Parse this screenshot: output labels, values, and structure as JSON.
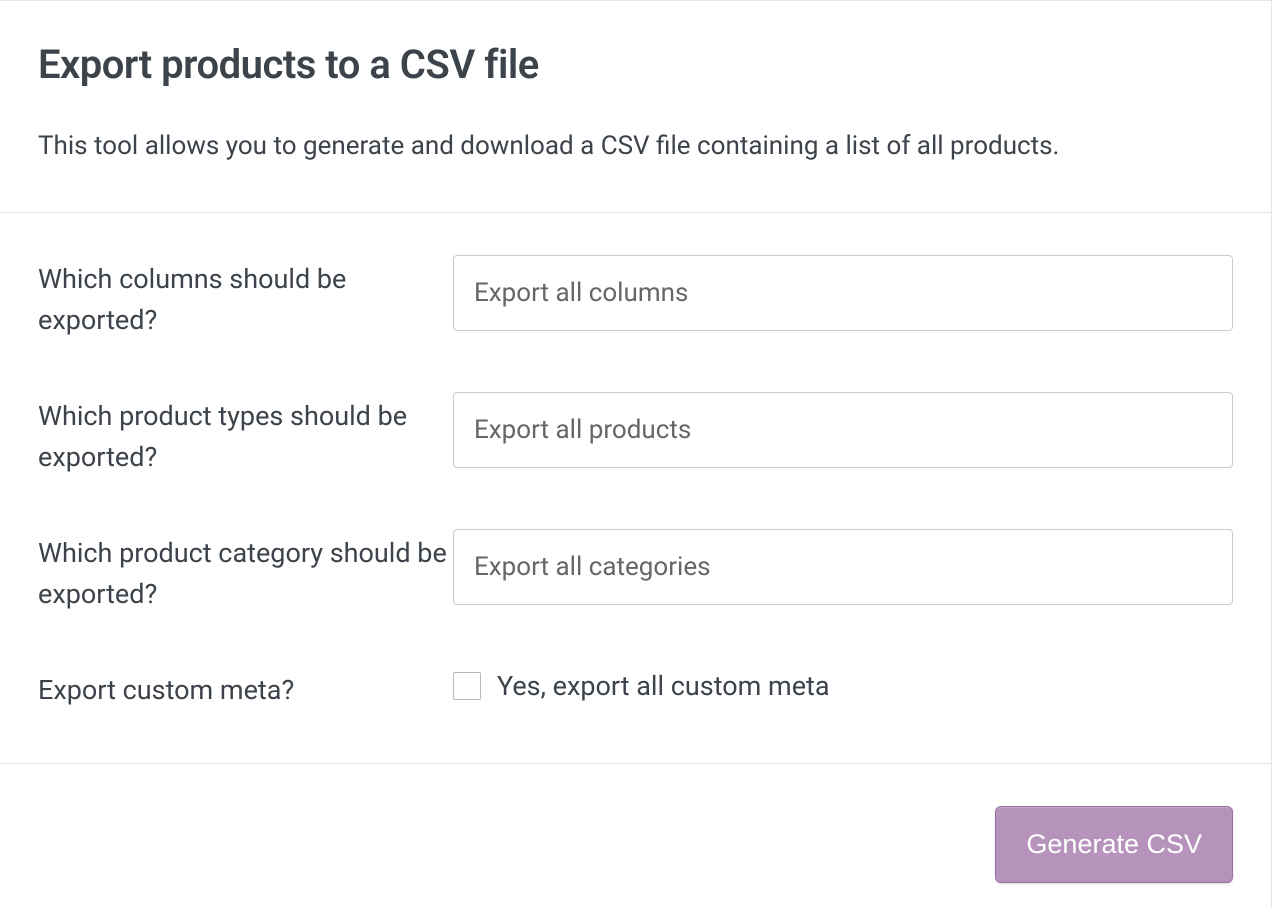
{
  "header": {
    "title": "Export products to a CSV file",
    "description": "This tool allows you to generate and download a CSV file containing a list of all products."
  },
  "form": {
    "columns": {
      "label": "Which columns should be exported?",
      "value": "Export all columns"
    },
    "productTypes": {
      "label": "Which product types should be exported?",
      "value": "Export all products"
    },
    "category": {
      "label": "Which product category should be exported?",
      "value": "Export all categories"
    },
    "customMeta": {
      "label": "Export custom meta?",
      "checkboxLabel": "Yes, export all custom meta"
    }
  },
  "footer": {
    "generateBtn": "Generate CSV"
  }
}
